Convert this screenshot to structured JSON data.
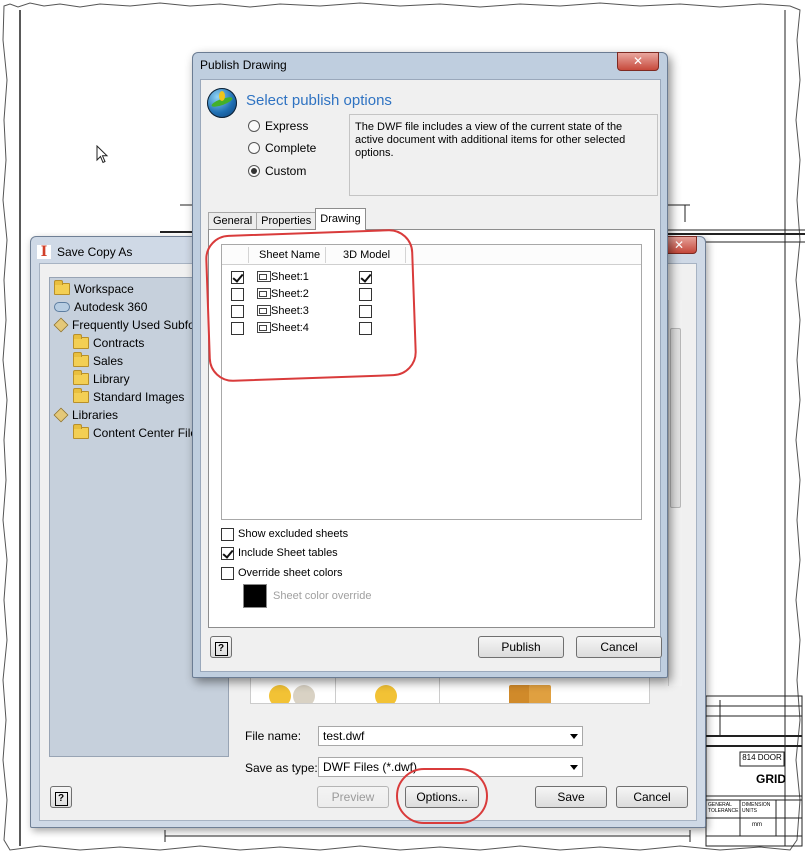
{
  "background_drawing": {
    "title_block": {
      "door_label": "814 DOOR",
      "grid_label": "GRID",
      "general_tolerance": "GENERAL TOLERANCE",
      "dimension_units": "DIMENSION UNITS",
      "units_value": "mm"
    }
  },
  "save_copy_as": {
    "title": "Save Copy As",
    "close_glyph": "✕",
    "tree": [
      {
        "label": "Workspace",
        "icon": "folder-icon",
        "indent": 0
      },
      {
        "label": "Autodesk 360",
        "icon": "cloud-icon",
        "indent": 0
      },
      {
        "label": "Frequently Used Subfo",
        "icon": "library-icon",
        "indent": 0
      },
      {
        "label": "Contracts",
        "icon": "folder-icon",
        "indent": 1
      },
      {
        "label": "Sales",
        "icon": "folder-icon",
        "indent": 1
      },
      {
        "label": "Library",
        "icon": "folder-icon",
        "indent": 1
      },
      {
        "label": "Standard Images",
        "icon": "folder-icon",
        "indent": 1
      },
      {
        "label": "Libraries",
        "icon": "library-icon",
        "indent": 0
      },
      {
        "label": "Content Center File",
        "icon": "folder-icon",
        "indent": 1
      }
    ],
    "file_name_label": "File name:",
    "file_name_value": "test.dwf",
    "save_as_type_label": "Save as type:",
    "save_as_type_value": "DWF Files (*.dwf)",
    "buttons": {
      "help": "?",
      "preview": "Preview",
      "options": "Options...",
      "save": "Save",
      "cancel": "Cancel"
    }
  },
  "publish_drawing": {
    "title": "Publish Drawing",
    "close_glyph": "✕",
    "heading": "Select publish options",
    "options": [
      {
        "label": "Express",
        "selected": false
      },
      {
        "label": "Complete",
        "selected": false
      },
      {
        "label": "Custom",
        "selected": true
      }
    ],
    "description": "The DWF file includes a view of the current state of the active document with additional items for other selected options.",
    "tabs": [
      {
        "label": "General",
        "active": false
      },
      {
        "label": "Properties",
        "active": false
      },
      {
        "label": "Drawing",
        "active": true
      }
    ],
    "sheet_table": {
      "columns": [
        "Sheet Name",
        "3D Model"
      ],
      "rows": [
        {
          "include": true,
          "name": "Sheet:1",
          "model_3d": true
        },
        {
          "include": false,
          "name": "Sheet:2",
          "model_3d": false
        },
        {
          "include": false,
          "name": "Sheet:3",
          "model_3d": false
        },
        {
          "include": false,
          "name": "Sheet:4",
          "model_3d": false
        }
      ]
    },
    "checkboxes": [
      {
        "label": "Show excluded sheets",
        "checked": false
      },
      {
        "label": "Include Sheet tables",
        "checked": true
      },
      {
        "label": "Override sheet colors",
        "checked": false
      }
    ],
    "sheet_color_override_label": "Sheet color override",
    "sheet_color": "#000000",
    "buttons": {
      "help": "?",
      "publish": "Publish",
      "cancel": "Cancel"
    }
  },
  "colors": {
    "accent_heading": "#2f73c2",
    "annotation_red": "#d93b3b"
  }
}
